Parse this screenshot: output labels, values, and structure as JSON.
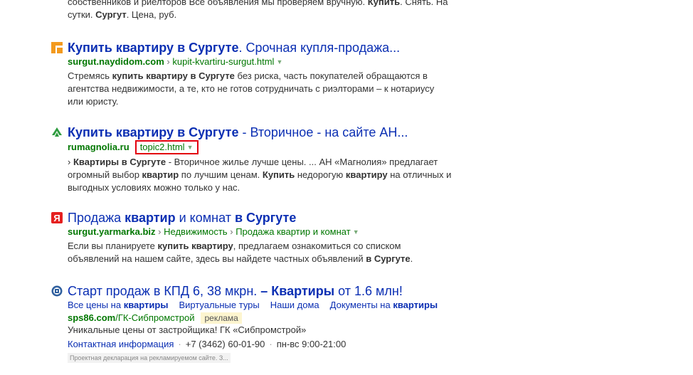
{
  "top_snippet": {
    "line1_a": "собственников и риелторов Все объявления мы проверяем вручную. ",
    "line1_b": "Купить",
    "line1_c": ". Снять. На",
    "line2_a": "сутки. ",
    "line2_b": "Сургут",
    "line2_c": ". Цена, руб."
  },
  "results": [
    {
      "title_bold": "Купить квартиру в Сургуте",
      "title_rest": ". Срочная купля-продажа...",
      "host": "surgut.naydidom.com",
      "path": "kupit-kvartiru-surgut.html",
      "snippet": {
        "a": "Стремясь ",
        "b": "купить квартиру в Сургуте",
        "c": " без риска, часть покупателей обращаются в агентства недвижимости, а те, кто не готов сотрудничать с риэлторами – к нотариусу или юристу."
      }
    },
    {
      "title_bold": "Купить квартиру в Сургуте",
      "title_rest": " - Вторичное - на сайте АН...",
      "host": "rumagnolia.ru",
      "path": "topic2.html",
      "snippet": {
        "a": "› ",
        "b": "Квартиры в Сургуте",
        "c": " - Вторичное жилье лучше цены. ... АН «Магнолия» предлагает огромный выбор ",
        "d": "квартир",
        "e": " по лучшим ценам. ",
        "f": "Купить",
        "g": " недорогую ",
        "h": "квартиру",
        "i": " на отличных и выгодных условиях можно только у нас."
      }
    },
    {
      "title_a": "Продажа ",
      "title_b": "квартир",
      "title_c": " и комнат ",
      "title_d": "в Сургуте",
      "host": "surgut.yarmarka.biz",
      "crumb1": "Недвижимость",
      "crumb2": "Продажа квартир и комнат",
      "snippet": {
        "a": "Если вы планируете ",
        "b": "купить квартиру",
        "c": ", предлагаем ознакомиться со списком объявлений на нашем сайте, здесь вы найдете частных объявлений ",
        "d": "в Сургуте",
        "e": "."
      }
    },
    {
      "title_a": "Старт продаж в КПД 6, 38 мкрн. ",
      "title_b": "– Квартиры",
      "title_c": " от 1.6 млн!",
      "sitelinks": [
        {
          "a": "Все цены на ",
          "b": "квартиры"
        },
        {
          "a": "Виртуальные туры",
          "b": ""
        },
        {
          "a": "Наши дома",
          "b": ""
        },
        {
          "a": "Документы на ",
          "b": "квартиры"
        }
      ],
      "host": "sps86.com",
      "path": "/ГК-Сибпромстрой",
      "ad_label": "реклама",
      "snippet": "Уникальные цены от застройщика! ГК «Сибпромстрой»",
      "contact_link": "Контактная информация",
      "phone": "+7 (3462) 60-01-90",
      "hours": "пн-вс 9:00-21:00",
      "disclaimer": "Проектная декларация на рекламируемом сайте. З..."
    }
  ]
}
